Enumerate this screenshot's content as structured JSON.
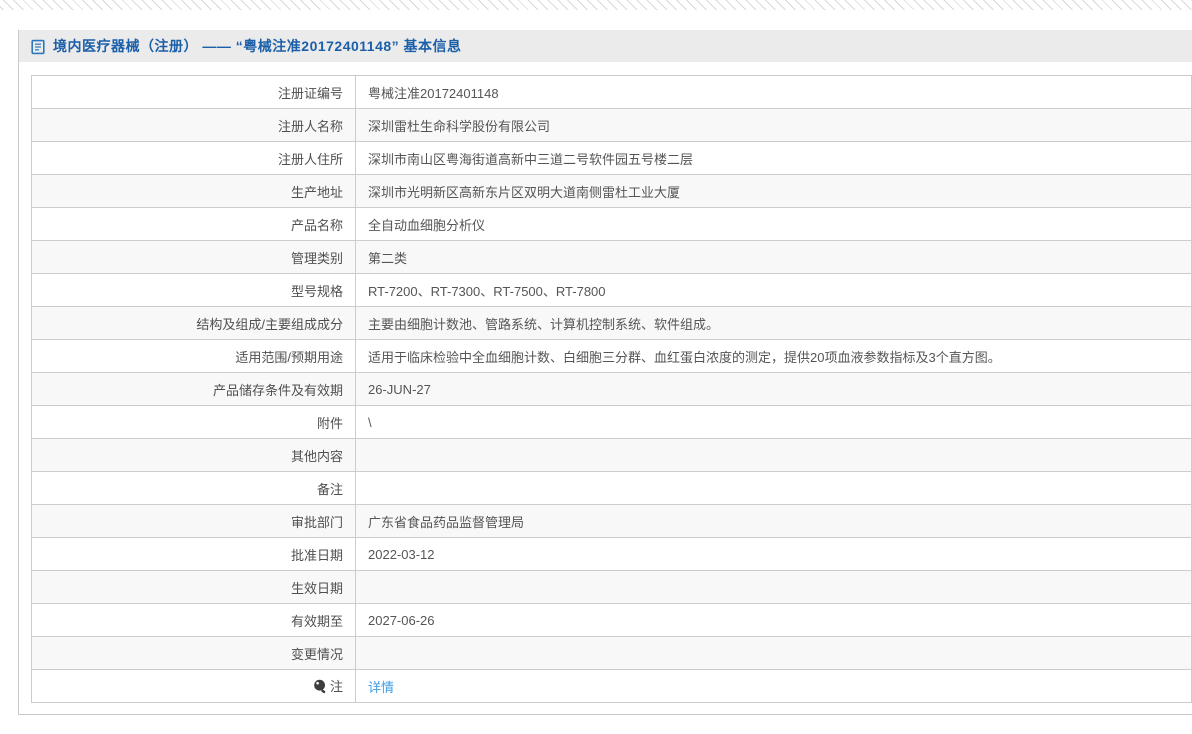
{
  "header": {
    "icon": "document-icon",
    "title": "境内医疗器械（注册） —— “粤械注准20172401148” 基本信息"
  },
  "table": {
    "rows": [
      {
        "label": "注册证编号",
        "value": "粤械注准20172401148"
      },
      {
        "label": "注册人名称",
        "value": "深圳雷杜生命科学股份有限公司"
      },
      {
        "label": "注册人住所",
        "value": "深圳市南山区粤海街道高新中三道二号软件园五号楼二层"
      },
      {
        "label": "生产地址",
        "value": "深圳市光明新区高新东片区双明大道南侧雷杜工业大厦"
      },
      {
        "label": "产品名称",
        "value": "全自动血细胞分析仪"
      },
      {
        "label": "管理类别",
        "value": "第二类"
      },
      {
        "label": "型号规格",
        "value": "RT-7200、RT-7300、RT-7500、RT-7800"
      },
      {
        "label": "结构及组成/主要组成成分",
        "value": "主要由细胞计数池、管路系统、计算机控制系统、软件组成。"
      },
      {
        "label": "适用范围/预期用途",
        "value": "适用于临床检验中全血细胞计数、白细胞三分群、血红蛋白浓度的测定，提供20项血液参数指标及3个直方图。"
      },
      {
        "label": "产品储存条件及有效期",
        "value": "26-JUN-27"
      },
      {
        "label": "附件",
        "value": "\\"
      },
      {
        "label": "其他内容",
        "value": ""
      },
      {
        "label": "备注",
        "value": ""
      },
      {
        "label": "审批部门",
        "value": "广东省食品药品监督管理局"
      },
      {
        "label": "批准日期",
        "value": "2022-03-12"
      },
      {
        "label": "生效日期",
        "value": ""
      },
      {
        "label": "有效期至",
        "value": "2027-06-26"
      },
      {
        "label": "变更情况",
        "value": ""
      },
      {
        "label": "注",
        "icon": "bulb-icon",
        "value": "详情",
        "link": true
      }
    ]
  },
  "colors": {
    "title_blue": "#1b5fa9",
    "link_blue": "#3f9ce8",
    "header_bar_bg": "#ebebeb",
    "row_alt_bg": "#f8f8f8",
    "border": "#cccccc"
  }
}
